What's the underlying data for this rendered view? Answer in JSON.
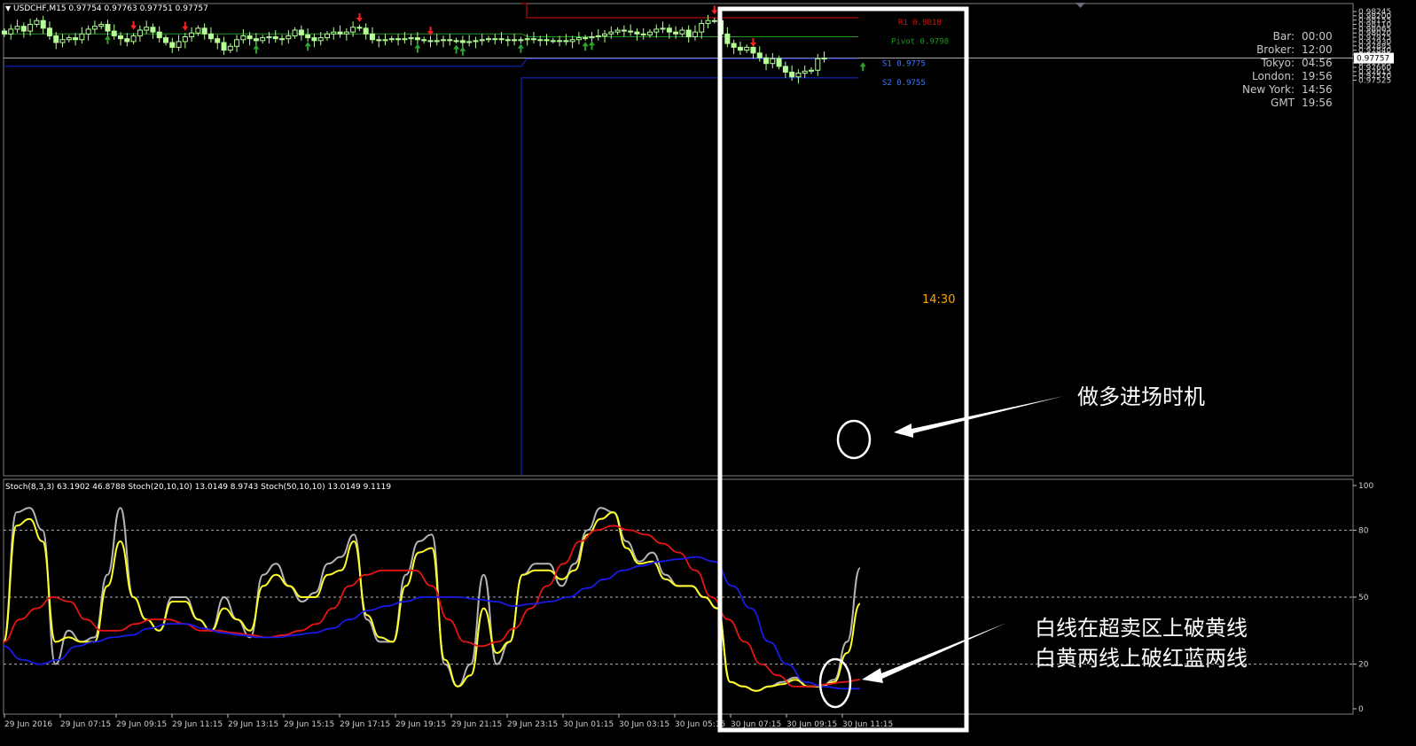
{
  "symbol_header": "USDCHF,M15  0.97754 0.97763 0.97751 0.97757",
  "stoch_header": "Stoch(8,3,3) 63.1902 46.8788  Stoch(20,10,10) 13.0149 8.9743  Stoch(50,10,10) 13.0149 9.1119",
  "clock": {
    "rows": [
      {
        "label": "Bar:",
        "value": "00:00"
      },
      {
        "label": "Broker:",
        "value": "12:00"
      },
      {
        "label": "Tokyo:",
        "value": "04:56"
      },
      {
        "label": "London:",
        "value": "19:56"
      },
      {
        "label": "New York:",
        "value": "14:56"
      },
      {
        "label": "GMT",
        "value": "19:56"
      }
    ]
  },
  "countdown": "14:30",
  "annotations": {
    "entry": "做多进场时机",
    "stoch_line1": "白线在超卖区上破黄线",
    "stoch_line2": "白黄两线上破红蓝两线"
  },
  "colors": {
    "background": "#000000",
    "candle": "#b4ff96",
    "resistance": "#e01010",
    "pivot": "#1e9a1e",
    "support": "#1428dc",
    "stoch_fast": "#b4b4b4",
    "stoch_signal": "#ffff28",
    "stoch_mid": "#e61414",
    "stoch_slow": "#1a1ae6",
    "countdown": "#ffa500",
    "highlight": "#ffffff",
    "arrow_up": "#2ea62e",
    "arrow_down": "#ff2020"
  },
  "chart_data": [
    {
      "type": "candlestick",
      "title": "USDCHF,M15",
      "ohlc_header": {
        "open": 0.97754,
        "high": 0.97763,
        "low": 0.97751,
        "close": 0.97757
      },
      "y_axis": {
        "ticks": [
          "0.98245",
          "0.98200",
          "0.98155",
          "0.98110",
          "0.98065",
          "0.98020",
          "0.97975",
          "0.97930",
          "0.97885",
          "0.97840",
          "0.97795",
          "0.97705",
          "0.97660",
          "0.97615",
          "0.97570",
          "0.97525"
        ],
        "current_price": "0.97757",
        "ylim": [
          0.9752,
          0.9825
        ]
      },
      "levels": [
        {
          "name": "R1",
          "label": "R1 0.9818",
          "value": 0.9818
        },
        {
          "name": "Pivot",
          "label": "Pivot 0.9798",
          "value": 0.9798
        },
        {
          "name": "S1",
          "label": "S1 0.9775",
          "value": 0.9775
        },
        {
          "name": "S2",
          "label": "S2 0.9755",
          "value": 0.9755
        }
      ],
      "previous_day_levels": {
        "pivot": 0.9801,
        "s1": 0.9767
      },
      "closes": [
        0.9801,
        0.9806,
        0.9809,
        0.9804,
        0.9811,
        0.9815,
        0.9807,
        0.9799,
        0.9792,
        0.9795,
        0.9797,
        0.9795,
        0.9801,
        0.9806,
        0.9809,
        0.9811,
        0.9804,
        0.9799,
        0.9796,
        0.9793,
        0.9799,
        0.9805,
        0.9808,
        0.9803,
        0.9797,
        0.9792,
        0.9787,
        0.9793,
        0.9798,
        0.9802,
        0.9807,
        0.9801,
        0.9796,
        0.9792,
        0.9784,
        0.9788,
        0.9795,
        0.9799,
        0.9796,
        0.9794,
        0.9797,
        0.9798,
        0.9796,
        0.9796,
        0.9799,
        0.9805,
        0.98,
        0.9797,
        0.9794,
        0.9797,
        0.9801,
        0.9803,
        0.9801,
        0.9803,
        0.9808,
        0.9807,
        0.9801,
        0.9795,
        0.9794,
        0.9795,
        0.9796,
        0.9795,
        0.9796,
        0.9797,
        0.9795,
        0.9794,
        0.9793,
        0.9794,
        0.9795,
        0.9794,
        0.9794,
        0.9792,
        0.9793,
        0.9794,
        0.9795,
        0.9796,
        0.9796,
        0.9795,
        0.9795,
        0.9794,
        0.9795,
        0.9796,
        0.9795,
        0.9795,
        0.9794,
        0.9794,
        0.9794,
        0.9793,
        0.9795,
        0.9797,
        0.9797,
        0.9798,
        0.9799,
        0.9801,
        0.9803,
        0.9805,
        0.9804,
        0.9803,
        0.9801,
        0.98,
        0.9803,
        0.9806,
        0.9807,
        0.9803,
        0.9801,
        0.9805,
        0.9798,
        0.9803,
        0.9812,
        0.9815,
        0.9815,
        0.9801,
        0.9791,
        0.9787,
        0.9784,
        0.9787,
        0.9781,
        0.9776,
        0.977,
        0.9775,
        0.9767,
        0.9761,
        0.9756,
        0.976,
        0.9762,
        0.9763,
        0.9775,
        0.97757
      ],
      "signals": {
        "up_arrows": [
          16,
          39,
          47,
          64,
          70,
          71,
          80,
          90,
          91,
          133
        ],
        "down_arrows": [
          20,
          28,
          55,
          66,
          110,
          116
        ]
      },
      "countdown_label": "14:30"
    },
    {
      "type": "line",
      "title": "Stoch(8,3,3) 63.1902 46.8788  Stoch(20,10,10) 13.0149 8.9743  Stoch(50,10,10) 13.0149 9.1119",
      "y_axis": {
        "ticks": [
          "100",
          "80",
          "50",
          "20",
          "0"
        ],
        "levels": [
          80,
          50,
          20
        ],
        "ylim": [
          0,
          100
        ]
      },
      "x_axis": {
        "ticks": [
          "29 Jun 2016",
          "29 Jun 07:15",
          "29 Jun 09:15",
          "29 Jun 11:15",
          "29 Jun 13:15",
          "29 Jun 15:15",
          "29 Jun 17:15",
          "29 Jun 19:15",
          "29 Jun 21:15",
          "29 Jun 23:15",
          "30 Jun 01:15",
          "30 Jun 03:15",
          "30 Jun 05:15",
          "30 Jun 07:15",
          "30 Jun 09:15",
          "30 Jun 11:15"
        ]
      },
      "series": [
        {
          "name": "Stoch(8,3,3) main",
          "values": [
            30,
            88,
            90,
            80,
            20,
            35,
            30,
            32,
            60,
            90,
            50,
            40,
            35,
            50,
            50,
            40,
            35,
            50,
            40,
            32,
            60,
            65,
            55,
            48,
            52,
            65,
            68,
            78,
            40,
            30,
            30,
            60,
            75,
            78,
            20,
            10,
            20,
            60,
            20,
            30,
            60,
            65,
            65,
            55,
            65,
            80,
            90,
            88,
            75,
            66,
            70,
            60,
            55,
            55,
            50,
            45,
            12,
            10,
            8,
            10,
            12,
            14,
            10,
            10,
            13,
            30,
            63
          ]
        },
        {
          "name": "Stoch(8,3,3) signal",
          "values": [
            30,
            82,
            85,
            75,
            30,
            32,
            30,
            30,
            55,
            75,
            50,
            40,
            35,
            48,
            48,
            40,
            35,
            45,
            40,
            35,
            55,
            60,
            55,
            50,
            50,
            60,
            62,
            75,
            42,
            32,
            30,
            55,
            70,
            72,
            22,
            10,
            15,
            45,
            25,
            30,
            60,
            62,
            62,
            58,
            62,
            78,
            85,
            88,
            72,
            65,
            66,
            58,
            55,
            55,
            50,
            45,
            12,
            10,
            8,
            10,
            11,
            13,
            10,
            10,
            12,
            25,
            47
          ]
        },
        {
          "name": "Stoch(20,10,10) main",
          "values": [
            30,
            40,
            45,
            50,
            48,
            40,
            35,
            35,
            38,
            40,
            40,
            38,
            35,
            35,
            34,
            33,
            32,
            33,
            35,
            38,
            45,
            55,
            60,
            62,
            62,
            62,
            55,
            40,
            30,
            28,
            30,
            36,
            45,
            55,
            65,
            75,
            80,
            82,
            80,
            78,
            74,
            70,
            62,
            50,
            40,
            30,
            20,
            15,
            10,
            10,
            11,
            12,
            13
          ]
        },
        {
          "name": "Stoch(50,10,10) main",
          "values": [
            28,
            22,
            20,
            22,
            28,
            30,
            32,
            33,
            36,
            38,
            38,
            36,
            34,
            33,
            32,
            32,
            33,
            34,
            36,
            40,
            44,
            46,
            48,
            50,
            50,
            50,
            49,
            48,
            46,
            47,
            48,
            50,
            54,
            58,
            62,
            64,
            66,
            67,
            68,
            66,
            55,
            45,
            30,
            20,
            12,
            10,
            9,
            9
          ]
        }
      ],
      "series_shortname": [
        "Stoch(8,3,3)",
        "Stoch(20,10,10)",
        "Stoch(50,10,10)"
      ]
    }
  ]
}
